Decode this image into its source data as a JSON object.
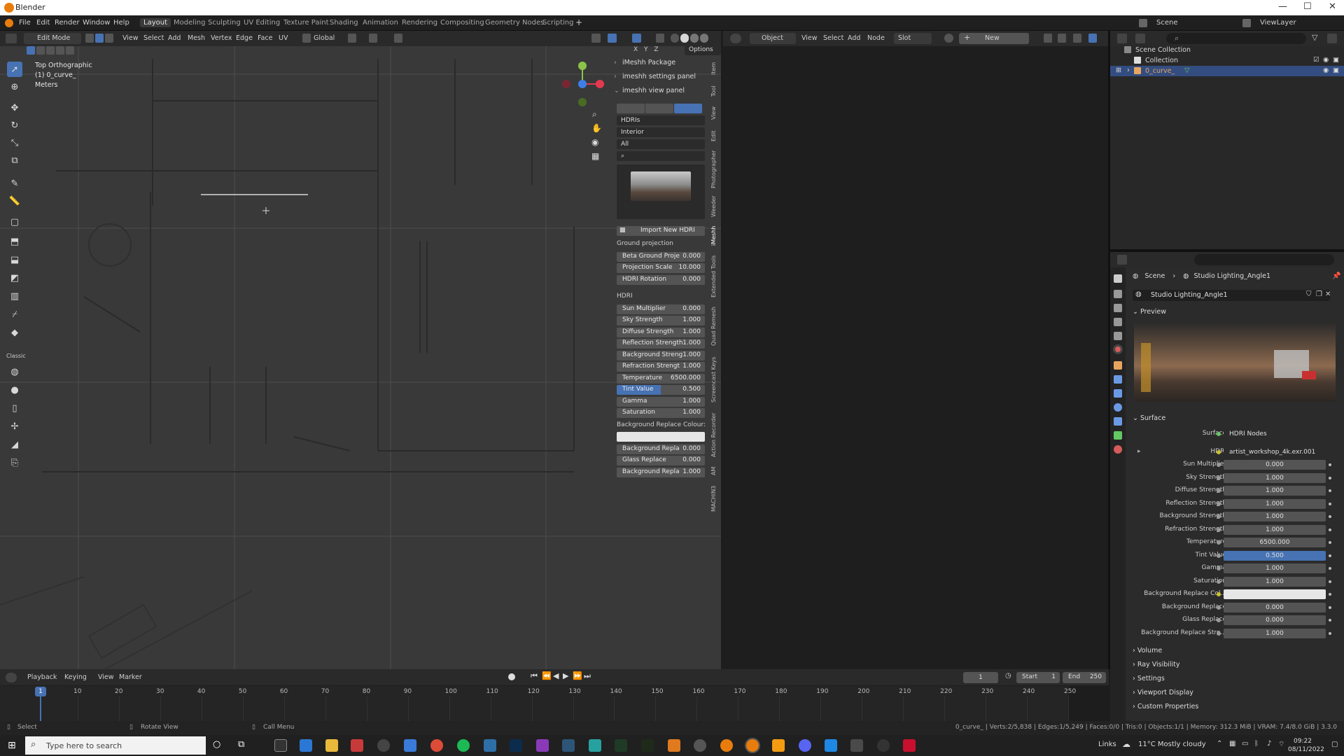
{
  "app": {
    "window_title": "Blender",
    "menu": [
      "File",
      "Edit",
      "Render",
      "Window",
      "Help"
    ],
    "workspaces": [
      "Layout",
      "Modeling",
      "Sculpting",
      "UV Editing",
      "Texture Paint",
      "Shading",
      "Animation",
      "Rendering",
      "Compositing",
      "Geometry Nodes",
      "Scripting"
    ],
    "active_workspace": "Layout",
    "scene_label": "Scene",
    "viewlayer_label": "ViewLayer"
  },
  "viewport": {
    "mode": "Edit Mode",
    "menus": [
      "View",
      "Select",
      "Add",
      "Mesh",
      "Vertex",
      "Edge",
      "Face",
      "UV"
    ],
    "orientation": "Global",
    "options": "Options",
    "view_name": "Top Orthographic",
    "object_label": "(1) 0_curve_",
    "units": "Meters",
    "axis_x": "X",
    "axis_y": "Y",
    "axis_z": "Z",
    "tool_classic": "Classic"
  },
  "npanel": {
    "sections": [
      {
        "label": "iMeshh Package",
        "open": false
      },
      {
        "label": "imeshh settings panel",
        "open": false
      },
      {
        "label": "imeshh view panel",
        "open": true
      }
    ],
    "category_select": "HDRIs",
    "subcategory_select": "Interior",
    "filter_select": "All",
    "import_button": "Import New HDRI",
    "ground_heading": "Ground projection",
    "ground_rows": [
      {
        "label": "Beta Ground Proje",
        "value": "0.000"
      },
      {
        "label": "Projection Scale",
        "value": "10.000"
      },
      {
        "label": "HDRI Rotation",
        "value": "0.000"
      }
    ],
    "hdri_heading": "HDRI",
    "hdri_rows": [
      {
        "label": "Sun Multiplier",
        "value": "0.000"
      },
      {
        "label": "Sky Strength",
        "value": "1.000"
      },
      {
        "label": "Diffuse Strength",
        "value": "1.000"
      },
      {
        "label": "Reflection Strength",
        "value": "1.000"
      },
      {
        "label": "Background Streng",
        "value": "1.000"
      },
      {
        "label": "Refraction Strengt",
        "value": "1.000"
      },
      {
        "label": "Temperature",
        "value": "6500.000"
      },
      {
        "label": "Tint Value",
        "value": "0.500"
      },
      {
        "label": "Gamma",
        "value": "1.000"
      },
      {
        "label": "Saturation",
        "value": "1.000"
      }
    ],
    "bg_replace_heading": "Background Replace Colour:",
    "bg_rows": [
      {
        "label": "Background Repla",
        "value": "0.000"
      },
      {
        "label": "Glass Replace",
        "value": "0.000"
      },
      {
        "label": "Background Repla",
        "value": "1.000"
      }
    ],
    "vertical_tabs": [
      "Item",
      "Tool",
      "View",
      "Edit",
      "Photographer",
      "Weeder",
      "iMeshh",
      "Extended Tools",
      "Quad Remesh",
      "Screencast Keys",
      "Action Recorder",
      "AM",
      "MACHIN3"
    ]
  },
  "shader_header": {
    "object": "Object",
    "menus": [
      "View",
      "Select",
      "Add",
      "Node"
    ],
    "slot": "Slot",
    "new_button": "New"
  },
  "outliner": {
    "rows": [
      {
        "label": "Scene Collection",
        "indent": 0
      },
      {
        "label": "Collection",
        "indent": 1
      },
      {
        "label": "0_curve_",
        "indent": 1,
        "selected": true
      }
    ]
  },
  "properties": {
    "breadcrumb_scene": "Scene",
    "breadcrumb_world": "Studio Lighting_Angle1",
    "world_name": "Studio Lighting_Angle1",
    "preview_label": "Preview",
    "surface_label": "Surface",
    "surface_field_label": "Surface",
    "surface_value": "HDRI Nodes",
    "hdri_label": "HDRI",
    "hdri_value": "artist_workshop_4k.exr.001",
    "rows": [
      {
        "label": "Sun Multiplier",
        "value": "0.000"
      },
      {
        "label": "Sky Strength",
        "value": "1.000"
      },
      {
        "label": "Diffuse Strength",
        "value": "1.000"
      },
      {
        "label": "Reflection Strength",
        "value": "1.000"
      },
      {
        "label": "Background Strength",
        "value": "1.000"
      },
      {
        "label": "Refraction Strength",
        "value": "1.000"
      },
      {
        "label": "Temperature",
        "value": "6500.000"
      },
      {
        "label": "Tint Value",
        "value": "0.500"
      },
      {
        "label": "Gamma",
        "value": "1.000"
      },
      {
        "label": "Saturation",
        "value": "1.000"
      },
      {
        "label": "Background Replace Col...",
        "value": ""
      },
      {
        "label": "Background Replace",
        "value": "0.000"
      },
      {
        "label": "Glass Replace",
        "value": "0.000"
      },
      {
        "label": "Background Replace Stre...",
        "value": "1.000"
      }
    ],
    "collapsed_sections": [
      "Volume",
      "Ray Visibility",
      "Settings",
      "Viewport Display",
      "Custom Properties"
    ]
  },
  "timeline": {
    "menus": [
      "Playback",
      "Keying",
      "View",
      "Marker"
    ],
    "current_frame": "1",
    "start_label": "Start",
    "start": "1",
    "end_label": "End",
    "end": "250",
    "ticks": [
      "1",
      "10",
      "20",
      "30",
      "40",
      "50",
      "60",
      "70",
      "80",
      "90",
      "100",
      "110",
      "120",
      "130",
      "140",
      "150",
      "160",
      "170",
      "180",
      "190",
      "200",
      "210",
      "220",
      "230",
      "240",
      "250"
    ]
  },
  "status": {
    "left": "Select",
    "mid": "Rotate View",
    "right": "Call Menu",
    "stats": "0_curve_ | Verts:2/5,838 | Edges:1/5,249 | Faces:0/0 | Tris:0 | Objects:1/1 | Memory: 312.3 MiB | VRAM: 7.4/8.0 GiB | 3.3.0"
  },
  "taskbar": {
    "search_placeholder": "Type here to search",
    "links": "Links",
    "weather": "11°C  Mostly cloudy",
    "time": "09:22",
    "date": "08/11/2022"
  },
  "colors": {
    "accent": "#4772b3",
    "blender_orange": "#e87d0d"
  }
}
